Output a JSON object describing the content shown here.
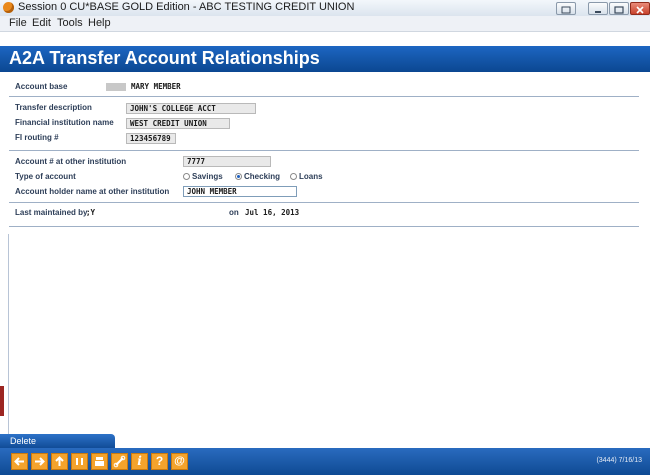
{
  "window": {
    "title": "Session 0 CU*BASE GOLD Edition - ABC TESTING CREDIT UNION",
    "app_icon": "cu-base-app-icon"
  },
  "menu": [
    "File",
    "Edit",
    "Tools",
    "Help"
  ],
  "header": {
    "title": "A2A Transfer Account Relationships"
  },
  "account_base": {
    "label": "Account base",
    "value": "MARY MEMBER"
  },
  "transfer": {
    "description_label": "Transfer description",
    "description_value": "JOHN'S COLLEGE ACCT",
    "institution_label": "Financial institution name",
    "institution_value": "WEST CREDIT UNION",
    "routing_label": "FI routing #",
    "routing_value": "123456789"
  },
  "account": {
    "number_label": "Account # at other institution",
    "number_value": "7777",
    "type_label": "Type of account",
    "types": [
      {
        "label": "Savings",
        "selected": false
      },
      {
        "label": "Checking",
        "selected": true
      },
      {
        "label": "Loans",
        "selected": false
      }
    ],
    "holder_label": "Account holder name at other institution",
    "holder_value": "JOHN MEMBER"
  },
  "maintenance": {
    "label": "Last maintained by",
    "user": ";Y",
    "on_label": "on",
    "date": "Jul 16, 2013"
  },
  "actions": {
    "delete_label": "Delete"
  },
  "toolbar": {
    "buttons": [
      "back-arrow-icon",
      "forward-arrow-icon",
      "up-arrow-icon",
      "pause-icon",
      "print-icon",
      "link-icon",
      "info-icon",
      "help-icon",
      "at-icon"
    ],
    "status": "(3444) 7/16/13"
  },
  "colors": {
    "header_blue": "#0b4791",
    "label_text": "#2d3e58",
    "toolbar_button": "#f4a32c"
  }
}
